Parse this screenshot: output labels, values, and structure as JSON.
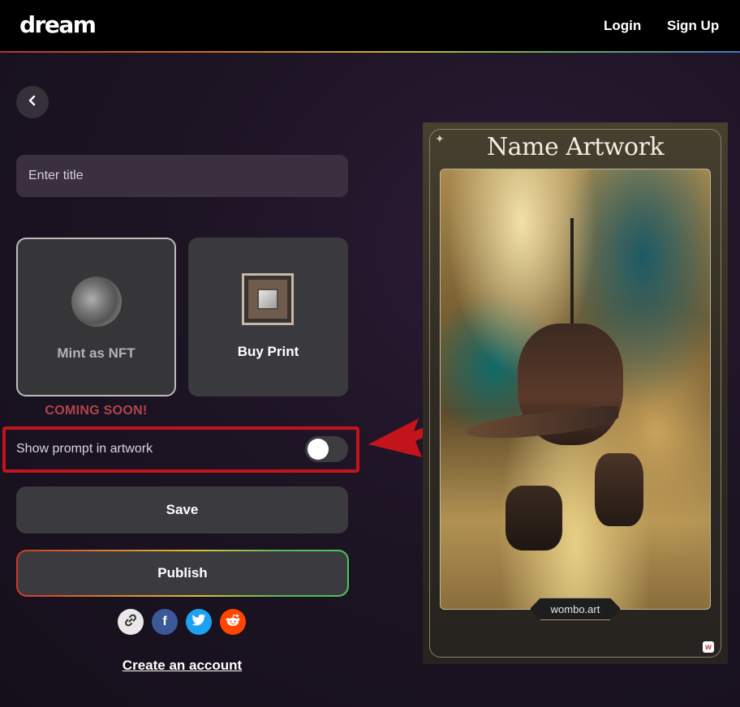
{
  "header": {
    "logo": "dream",
    "login_label": "Login",
    "signup_label": "Sign Up"
  },
  "form": {
    "title_placeholder": "Enter title",
    "title_value": "",
    "nft_card_label": "Mint as NFT",
    "print_card_label": "Buy Print",
    "coming_soon": "COMING SOON!",
    "toggle_label": "Show prompt in artwork",
    "toggle_on": false,
    "save_label": "Save",
    "publish_label": "Publish",
    "create_account_label": "Create an account"
  },
  "share": {
    "icons": [
      "link-icon",
      "facebook-icon",
      "twitter-icon",
      "reddit-icon"
    ],
    "colors": {
      "link": "#e9e9e9",
      "facebook": "#3b5998",
      "twitter": "#1da1f2",
      "reddit": "#ff4500"
    }
  },
  "artwork": {
    "title": "Name Artwork",
    "watermark": "wombo.art"
  },
  "colors": {
    "annotation_red": "#c4141b",
    "coming_soon": "#b0454b"
  }
}
